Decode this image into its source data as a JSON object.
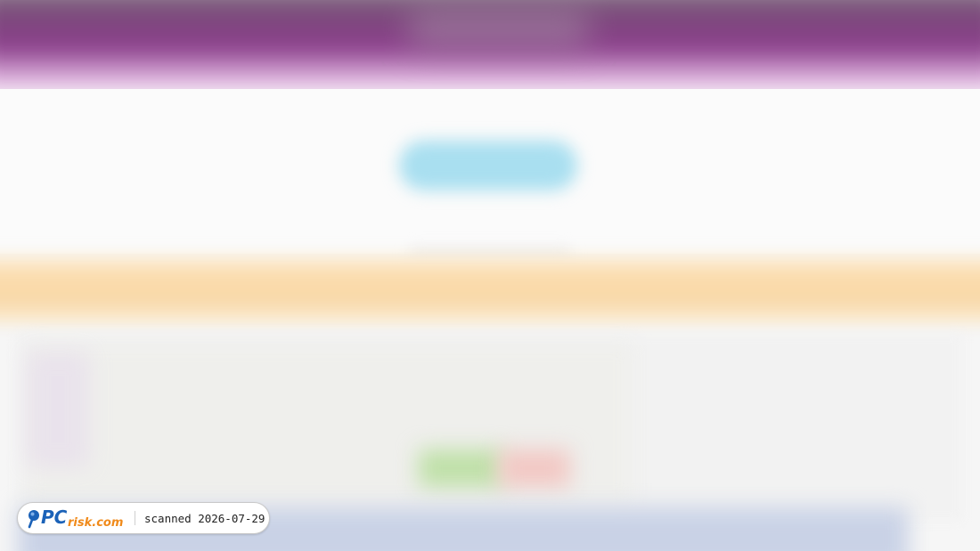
{
  "watermark": {
    "logo_text": "PCrisk.com",
    "label": "scanned 2026-07-29"
  },
  "colors": {
    "header_purple": "#8b3f8b",
    "cta_blue": "#a9dff0",
    "banner_orange": "#f9d8a8",
    "button_green": "#bfe0a8",
    "button_red": "#f2c8c4",
    "logo_blue": "#1b62b8",
    "logo_orange": "#f08a1a"
  },
  "icons": {
    "logo": "magnifier-icon"
  }
}
